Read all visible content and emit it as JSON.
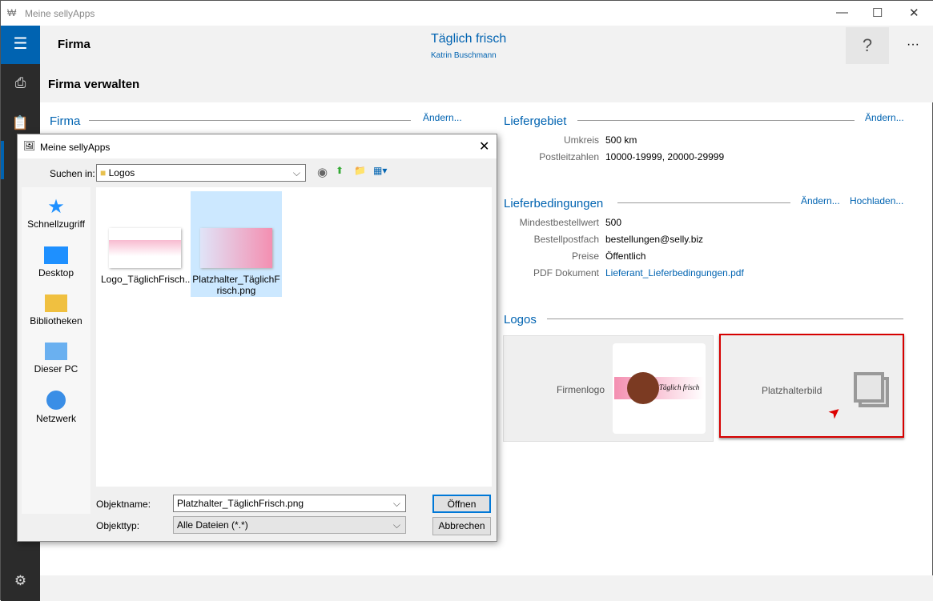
{
  "window": {
    "title": "Meine sellyApps",
    "minimize": "—",
    "maximize": "☐",
    "close": "✕"
  },
  "header": {
    "section": "Firma",
    "company": "Täglich frisch",
    "user": "Katrin Buschmann",
    "help": "?",
    "more": "···"
  },
  "page": {
    "title": "Firma verwalten"
  },
  "firma": {
    "title": "Firma",
    "change": "Ändern..."
  },
  "liefergebiet": {
    "title": "Liefergebiet",
    "change": "Ändern...",
    "rows": [
      {
        "label": "Umkreis",
        "value": "500 km"
      },
      {
        "label": "Postleitzahlen",
        "value": "10000-19999, 20000-29999"
      }
    ]
  },
  "lieferbedingungen": {
    "title": "Lieferbedingungen",
    "change": "Ändern...",
    "upload": "Hochladen...",
    "rows": [
      {
        "label": "Mindestbestellwert",
        "value": "500"
      },
      {
        "label": "Bestellpostfach",
        "value": "bestellungen@selly.biz"
      },
      {
        "label": "Preise",
        "value": "Öffentlich"
      },
      {
        "label": "PDF Dokument",
        "value": "Lieferant_Lieferbedingungen.pdf"
      }
    ]
  },
  "logos": {
    "title": "Logos",
    "firmenlogo": "Firmenlogo",
    "platzhalter": "Platzhalterbild",
    "logo_text": "Täglich frisch"
  },
  "dialog": {
    "title": "Meine sellyApps",
    "look_in_label": "Suchen in:",
    "look_in": "Logos",
    "places": [
      "Schnellzugriff",
      "Desktop",
      "Bibliotheken",
      "Dieser PC",
      "Netzwerk"
    ],
    "files": [
      {
        "name": "Logo_TäglichFrisch...",
        "selected": false
      },
      {
        "name": "Platzhalter_TäglichFrisch.png",
        "selected": true
      }
    ],
    "filename_label": "Objektname:",
    "filename": "Platzhalter_TäglichFrisch.png",
    "filetype_label": "Objekttyp:",
    "filetype": "Alle Dateien (*.*)",
    "open": "Öffnen",
    "cancel": "Abbrechen"
  },
  "colors": {
    "accent": "#0063b1",
    "highlight": "#cce8ff",
    "focus": "#d60000"
  }
}
